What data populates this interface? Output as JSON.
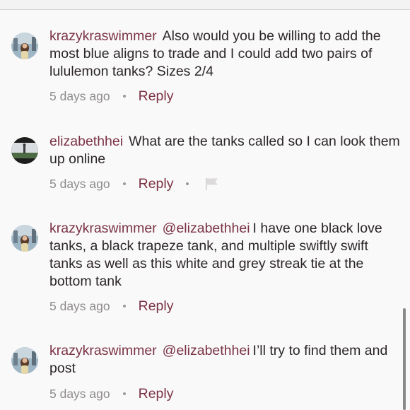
{
  "comments": [
    {
      "username": "krazykraswimmer",
      "mention": "",
      "text": "Also would you be willing to add the most blue aligns to trade and I could add two pairs of lululemon tanks? Sizes 2/4",
      "time": "5 days ago",
      "reply_label": "Reply",
      "avatar_icon": "profile-photo-icon",
      "has_flag": false
    },
    {
      "username": "elizabethhei",
      "mention": "",
      "text": "What are the tanks called so I can look them up online",
      "time": "5 days ago",
      "reply_label": "Reply",
      "avatar_icon": "profile-photo-icon",
      "has_flag": true
    },
    {
      "username": "krazykraswimmer",
      "mention": "@elizabethhei",
      "text": "I have one black love tanks, a black trapeze tank, and multiple swiftly swift tanks as well as this white and grey streak tie at the bottom tank",
      "time": "5 days ago",
      "reply_label": "Reply",
      "avatar_icon": "profile-photo-icon",
      "has_flag": false
    },
    {
      "username": "krazykraswimmer",
      "mention": "@elizabethhei",
      "text": "I’ll try to find them and post",
      "time": "5 days ago",
      "reply_label": "Reply",
      "avatar_icon": "profile-photo-icon",
      "has_flag": false
    }
  ],
  "colors": {
    "accent": "#7a3345",
    "text": "#2b2628",
    "muted": "#8e8b8d",
    "background": "#faf9fa"
  }
}
